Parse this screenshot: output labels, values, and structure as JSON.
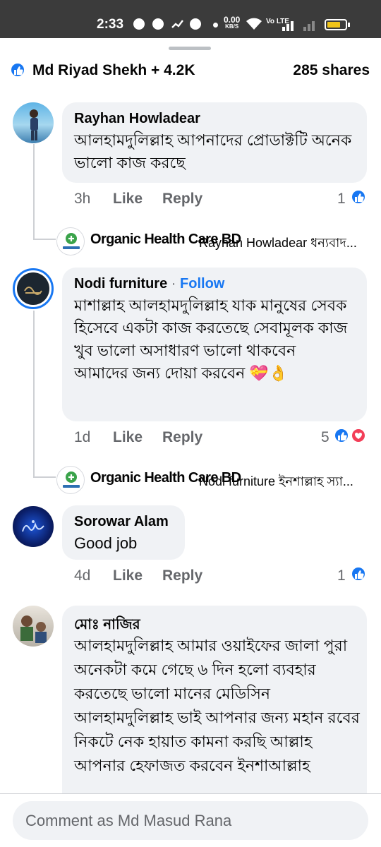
{
  "status_bar": {
    "time": "2:33",
    "net_speed_value": "0.00",
    "net_speed_unit": "KB/S",
    "volte": "Vo LTE",
    "battery_level": 0.75,
    "icons": [
      "facebook-icon",
      "messenger-icon",
      "missed-call-icon",
      "chat-icon",
      "wifi-icon",
      "signal-icon",
      "battery-icon"
    ]
  },
  "reactions_summary": {
    "reactors": "Md Riyad Shekh + 4.2K",
    "shares": "285 shares",
    "icon": "like-icon"
  },
  "comments": [
    {
      "author": "Rayhan Howladear",
      "text": "আলহামদুলিল্লাহ আপনাদের প্রোডাক্টটি অনেক ভালো কাজ করছে",
      "time": "3h",
      "like_label": "Like",
      "reply_label": "Reply",
      "reaction_count": "1",
      "reply": {
        "page": "Organic Health Care BD",
        "snippet": "Rayhan Howladear ধন্যবাদ..."
      }
    },
    {
      "author": "Nodi furniture",
      "follow_label": "Follow",
      "separator": "·",
      "text": "মাশাল্লাহ আলহামদুলিল্লাহ যাক মানুষের সেবক হিসেবে একটা কাজ করতেছে সেবামূলক কাজ খুব ভালো অসাধারণ ভালো থাকবেন আমাদের জন্য দোয়া করবেন 💝👌",
      "time": "1d",
      "like_label": "Like",
      "reply_label": "Reply",
      "reaction_count": "5",
      "reply": {
        "page": "Organic Health Care BD",
        "snippet": "Nodi furniture ইনশাল্লাহ স্যা..."
      }
    },
    {
      "author": "Sorowar Alam",
      "text": "Good job",
      "time": "4d",
      "like_label": "Like",
      "reply_label": "Reply",
      "reaction_count": "1"
    },
    {
      "author": "মোঃ নাজির",
      "text": "আলহামদুলিল্লাহ আমার ওয়াইফের জালা পুরা অনেকটা কমে গেছে ৬ দিন হলো ব্যবহার করতেছে ভালো মানের মেডিসিন আলহামদুলিল্লাহ ভাই আপনার জন্য মহান রবের নিকটে নেক হায়াত কামনা করছি আল্লাহ আপনার হেফাজত করবেন ইনশাআল্লাহ"
    }
  ],
  "composer": {
    "placeholder": "Comment as Md Masud Rana"
  },
  "colors": {
    "accent": "#1877f2",
    "bubble": "#f0f2f5",
    "muted": "#65676b",
    "heart": "#f33e58",
    "status_bar": "#3b3b3b"
  }
}
